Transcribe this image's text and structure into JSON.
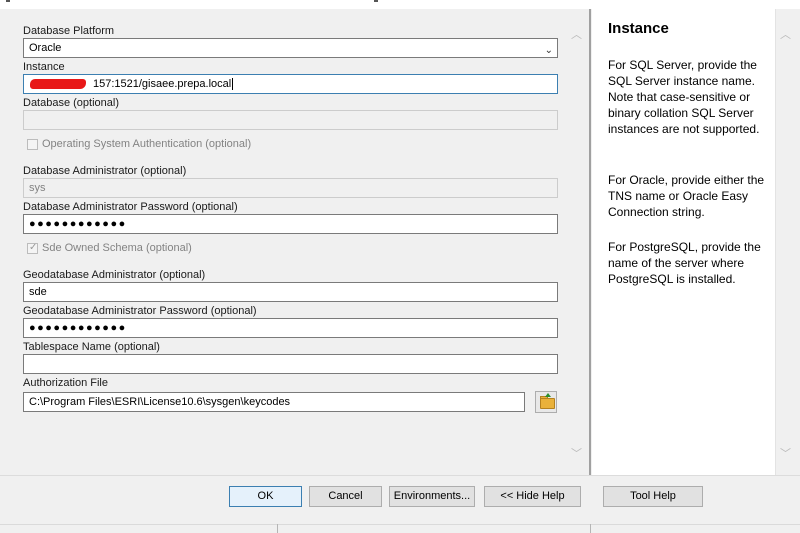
{
  "form": {
    "platform_label": "Database Platform",
    "platform_value": "Oracle",
    "instance_label": "Instance",
    "instance_value": "157:1521/gisaee.prepa.local",
    "database_label": "Database (optional)",
    "database_value": "",
    "os_auth_label": "Operating System Authentication (optional)",
    "os_auth_checked": false,
    "dba_label": "Database Administrator (optional)",
    "dba_value": "sys",
    "dba_password_label": "Database Administrator Password (optional)",
    "dba_password_value": "●●●●●●●●●●●●",
    "sde_owned_label": "Sde Owned Schema (optional)",
    "sde_owned_checked": true,
    "gdb_admin_label": "Geodatabase Administrator (optional)",
    "gdb_admin_value": "sde",
    "gdb_password_label": "Geodatabase Administrator Password (optional)",
    "gdb_password_value": "●●●●●●●●●●●●",
    "tablespace_label": "Tablespace Name (optional)",
    "tablespace_value": "",
    "auth_file_label": "Authorization File",
    "auth_file_value": "C:\\Program Files\\ESRI\\License10.6\\sysgen\\keycodes"
  },
  "help": {
    "title": "Instance",
    "paragraphs": [
      "For SQL Server, provide the SQL Server instance name. Note that case-sensitive or binary collation SQL Server instances are not supported.",
      "For Oracle, provide either the TNS name or Oracle Easy Connection string.",
      "For PostgreSQL, provide the name of the server where PostgreSQL is installed."
    ]
  },
  "buttons": {
    "ok": "OK",
    "cancel": "Cancel",
    "environments": "Environments...",
    "hide_help": "<< Hide Help",
    "tool_help": "Tool Help"
  },
  "icons": {
    "scroll_up": "chevron-up-icon",
    "scroll_down": "chevron-down-icon",
    "dropdown": "chevron-down-icon",
    "browse": "folder-open-icon",
    "check": "checkmark-icon"
  },
  "colors": {
    "focus_border": "#3c7fb1",
    "redaction": "#e81818",
    "folder": "#e9b13a"
  }
}
